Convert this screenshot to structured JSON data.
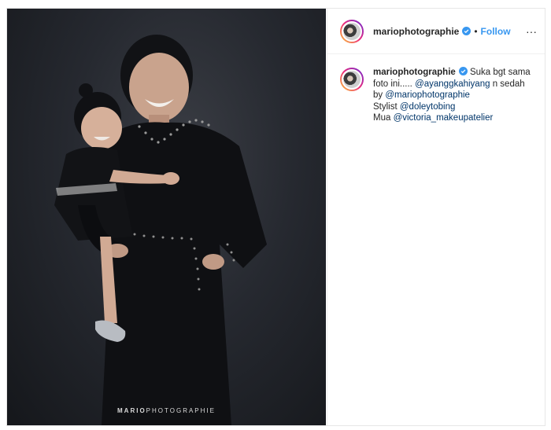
{
  "post": {
    "username": "mariophotographie",
    "separator": "•",
    "follow_label": "Follow",
    "more_icon": "···",
    "verified_color": "#3897f0",
    "photo": {
      "watermark_bold": "MARIO",
      "watermark_rest": "PHOTOGRAPHIE"
    }
  },
  "caption": {
    "username": "mariophotographie",
    "text_1": "Suka bgt sama foto ini.....",
    "mention_1": "@ayanggkahiyang",
    "text_2": "n sedah by",
    "mention_2": "@mariophotographie",
    "stylist_label": "Stylist",
    "mention_stylist": "@doleytobing",
    "mua_label": "Mua",
    "mention_mua": "@victoria_makeupatelier"
  }
}
